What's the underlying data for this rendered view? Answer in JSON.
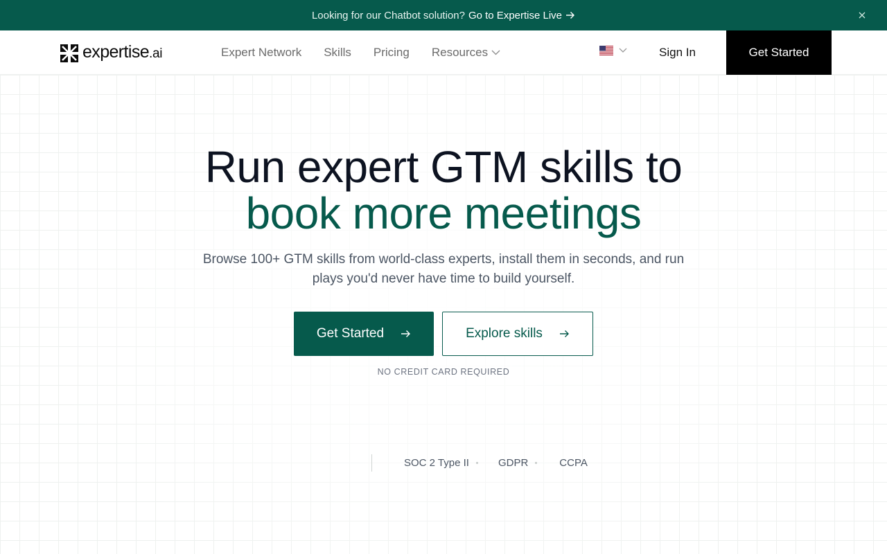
{
  "banner": {
    "text": "Looking for our Chatbot solution?",
    "link_label": "Go to Expertise Live",
    "arrow_icon": "arrow-right-icon",
    "close_icon": "close-icon"
  },
  "nav": {
    "logo_text": "expertise",
    "logo_suffix": ".ai",
    "links": [
      {
        "label": "Expert Network"
      },
      {
        "label": "Skills"
      },
      {
        "label": "Pricing"
      },
      {
        "label": "Resources",
        "has_dropdown": true
      }
    ],
    "language_icon": "us-flag-icon",
    "sign_in": "Sign In",
    "cta": "Get Started"
  },
  "hero": {
    "heading_line1": "Run expert GTM skills to",
    "heading_line2": "book more meetings",
    "subtitle": "Browse 100+ GTM skills from world-class experts, install them in seconds, and run plays you'd never have time to build yourself.",
    "primary_cta": "Get Started",
    "secondary_cta": "Explore skills",
    "note": "NO CREDIT CARD REQUIRED"
  },
  "compliance": {
    "items": [
      "SOC 2 Type II",
      "GDPR",
      "CCPA"
    ]
  },
  "colors": {
    "brand_green": "#065a4c",
    "nav_cta_bg": "#000000",
    "heading": "#0d1321"
  }
}
